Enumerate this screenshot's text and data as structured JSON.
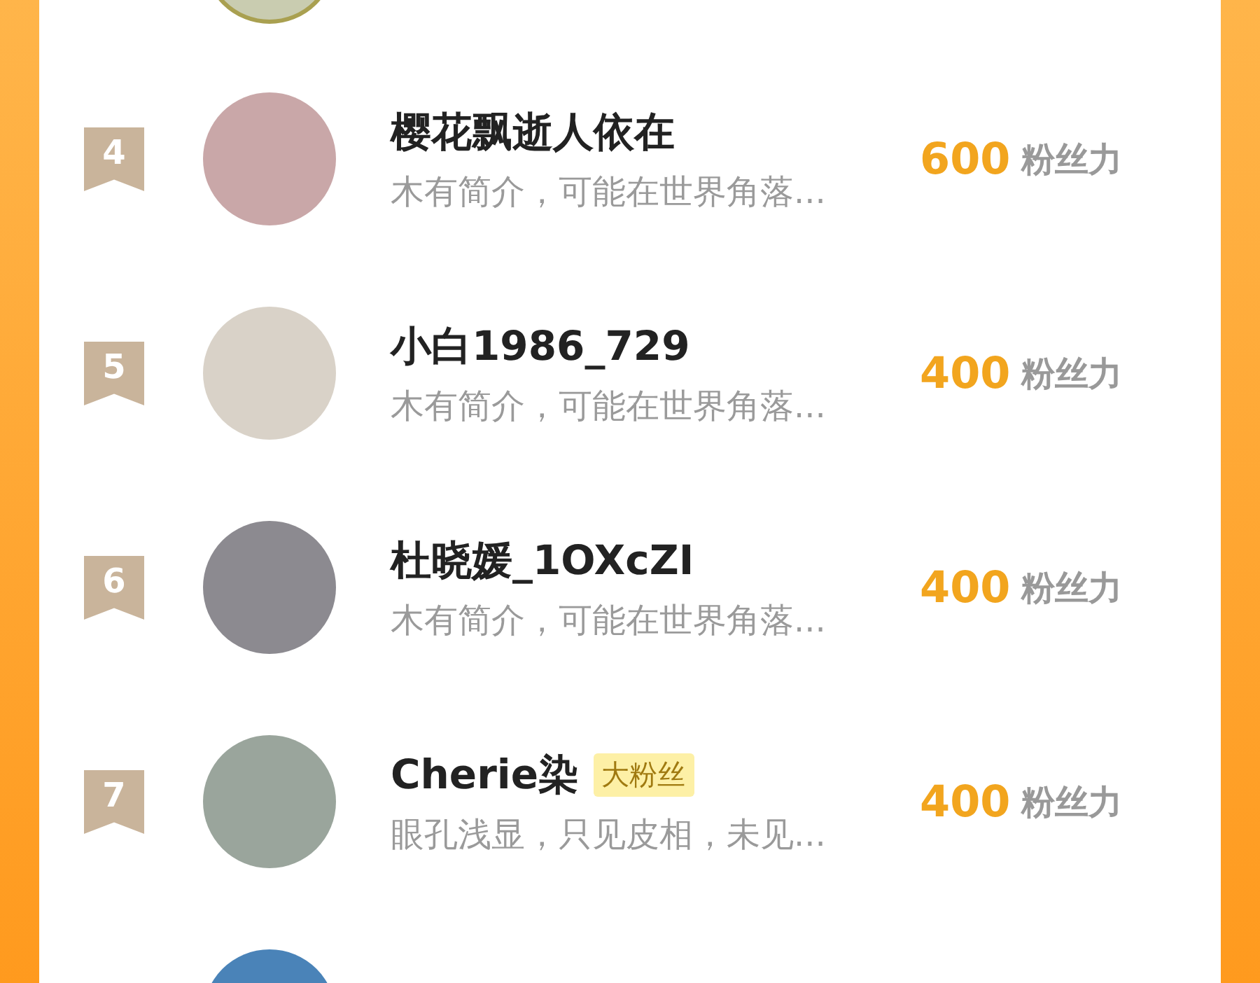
{
  "rows": [
    {
      "rank": "4",
      "name": "樱花飘逝人依在",
      "bio": "木有简介，可能在世界角落...",
      "score": "600",
      "unit": "粉丝力"
    },
    {
      "rank": "5",
      "name": "小白1986_729",
      "bio": "木有简介，可能在世界角落...",
      "score": "400",
      "unit": "粉丝力"
    },
    {
      "rank": "6",
      "name": "杜晓媛_1OXcZI",
      "bio": "木有简介，可能在世界角落...",
      "score": "400",
      "unit": "粉丝力"
    },
    {
      "rank": "7",
      "name": "Cherie染",
      "tag": "大粉丝",
      "bio": "眼孔浅显，只见皮相，未见...",
      "score": "400",
      "unit": "粉丝力"
    }
  ]
}
